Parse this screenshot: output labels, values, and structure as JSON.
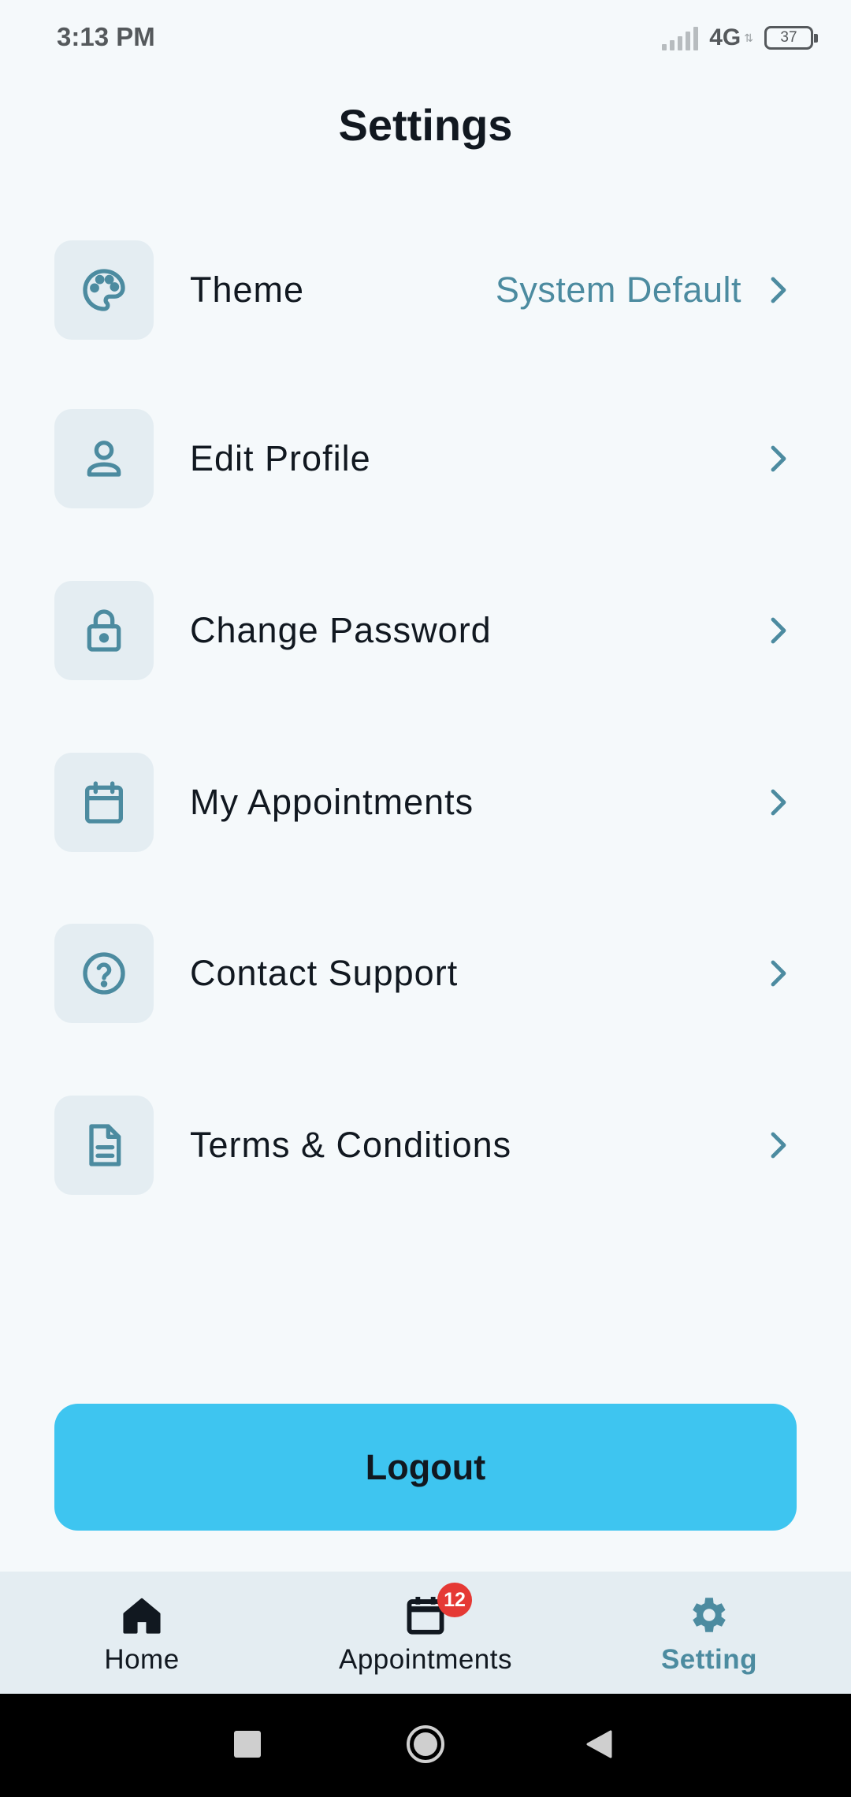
{
  "status_bar": {
    "time": "3:13 PM",
    "network": "4G",
    "battery": "37"
  },
  "header": {
    "title": "Settings"
  },
  "settings": {
    "items": [
      {
        "label": "Theme",
        "value": "System Default",
        "icon": "palette-icon"
      },
      {
        "label": "Edit Profile",
        "icon": "user-icon"
      },
      {
        "label": "Change Password",
        "icon": "lock-icon"
      },
      {
        "label": "My Appointments",
        "icon": "calendar-icon"
      },
      {
        "label": "Contact Support",
        "icon": "help-circle-icon"
      },
      {
        "label": "Terms & Conditions",
        "icon": "document-icon"
      }
    ]
  },
  "logout": {
    "label": "Logout"
  },
  "bottom_nav": {
    "items": [
      {
        "label": "Home",
        "icon": "home-icon",
        "active": false
      },
      {
        "label": "Appointments",
        "icon": "calendar-icon",
        "badge": "12",
        "active": false
      },
      {
        "label": "Setting",
        "icon": "gear-icon",
        "active": true
      }
    ]
  },
  "colors": {
    "accent": "#4c8ba0",
    "logout_bg": "#3ec5f0",
    "icon_tile": "#e4edf2",
    "badge": "#e53935"
  }
}
